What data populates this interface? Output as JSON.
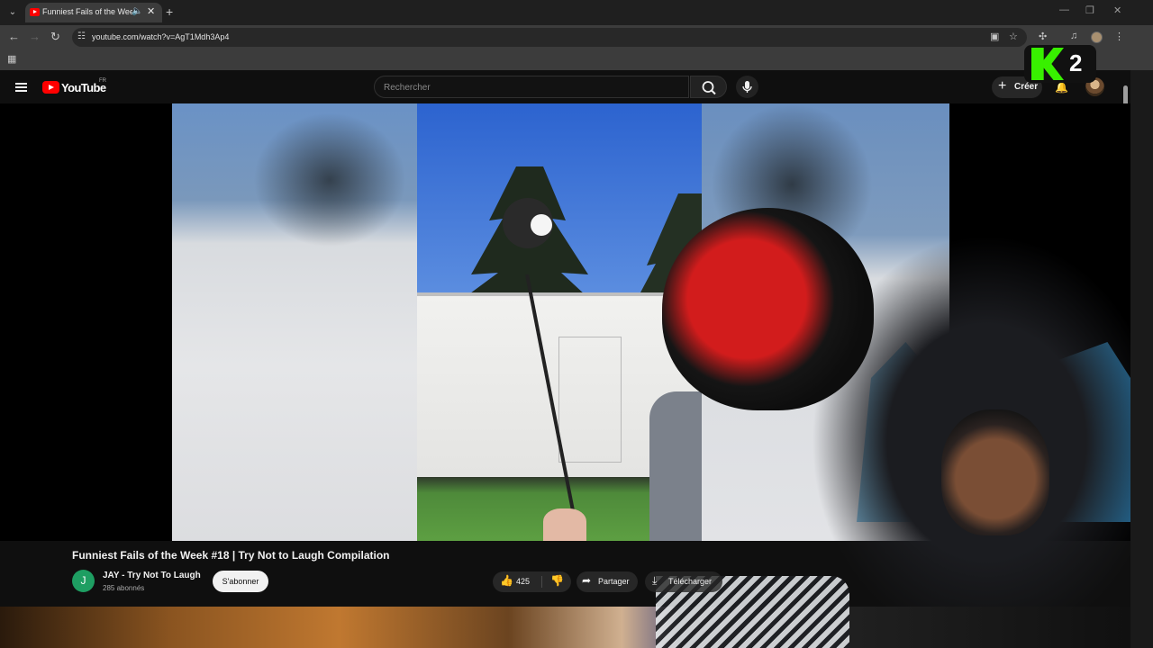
{
  "browser": {
    "tab_title": "Funniest Fails of the Week",
    "url": "youtube.com/watch?v=AgT1Mdh3Ap4"
  },
  "youtube": {
    "logo_text": "YouTube",
    "country_code": "FR",
    "search_placeholder": "Rechercher",
    "create_label": "Créer"
  },
  "brand": {
    "number": "2",
    "accent": "#38f000"
  },
  "video": {
    "title": "Funniest Fails of the Week #18 | Try Not to Laugh Compilation",
    "channel_initial": "J",
    "channel_name": "JAY - Try Not To Laugh",
    "subscribers": "285 abonnés",
    "subscribe_label": "S'abonner",
    "like_count": "425",
    "share_label": "Partager",
    "download_label": "Télécharger"
  },
  "colors": {
    "youtube_red": "#ff0000",
    "channel_avatar": "#1e9e62"
  }
}
